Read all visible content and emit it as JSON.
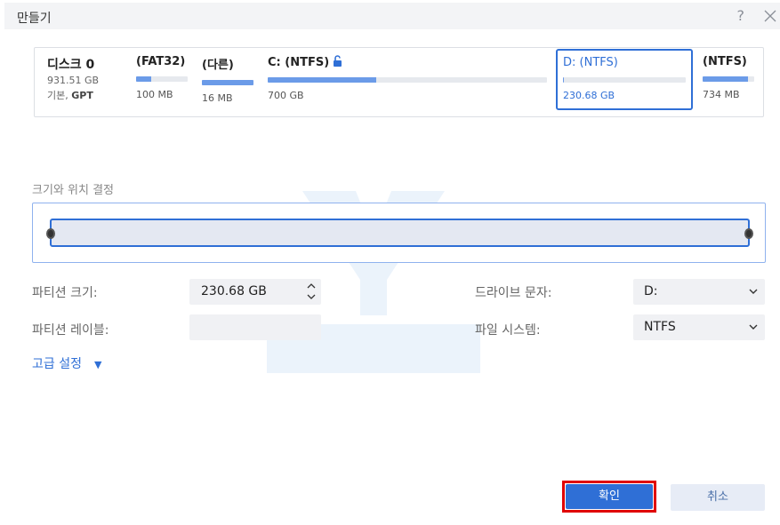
{
  "window": {
    "title": "만들기"
  },
  "disk": {
    "name": "디스크 0",
    "size": "931.51 GB",
    "type_prefix": "기본, ",
    "type_style": "GPT"
  },
  "partitions": [
    {
      "name": "(FAT32)",
      "size": "100 MB",
      "fill": 0.3
    },
    {
      "name": "(다른)",
      "size": "16 MB",
      "fill": 1.0
    },
    {
      "name": "C: (NTFS)",
      "size": "700 GB",
      "fill": 0.39
    },
    {
      "name": "D: (NTFS)",
      "size": "230.68 GB",
      "fill": 0.01
    },
    {
      "name": "(NTFS)",
      "size": "734 MB",
      "fill": 0.88
    }
  ],
  "section": {
    "label": "크기와 위치 결정"
  },
  "form": {
    "partition_size_label": "파티션 크기:",
    "partition_size_value": "230.68 GB",
    "partition_label_label": "파티션 레이블:",
    "partition_label_value": "",
    "drive_letter_label": "드라이브 문자:",
    "drive_letter_value": "D:",
    "file_system_label": "파일 시스템:",
    "file_system_value": "NTFS"
  },
  "advanced": {
    "label": "고급 설정"
  },
  "buttons": {
    "ok": "확인",
    "cancel": "취소"
  },
  "colors": {
    "accent": "#2f6fd6",
    "highlight": "#e00000",
    "bar_fill": "#6b9be8"
  }
}
